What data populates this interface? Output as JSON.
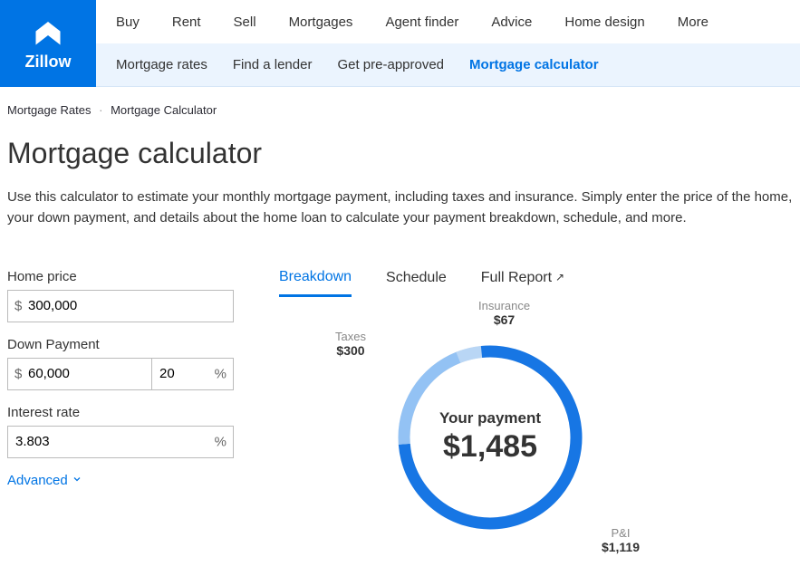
{
  "brand": "Zillow",
  "nav": {
    "primary": [
      "Buy",
      "Rent",
      "Sell",
      "Mortgages",
      "Agent finder",
      "Advice",
      "Home design",
      "More"
    ],
    "secondary": [
      "Mortgage rates",
      "Find a lender",
      "Get pre-approved",
      "Mortgage calculator"
    ],
    "secondary_active": 3
  },
  "breadcrumb": [
    "Mortgage Rates",
    "Mortgage Calculator"
  ],
  "page_title": "Mortgage calculator",
  "intro": "Use this calculator to estimate your monthly mortgage payment, including taxes and insurance. Simply enter the price of the home, your down payment, and details about the home loan to calculate your payment breakdown, schedule, and more.",
  "form": {
    "home_price_label": "Home price",
    "home_price_value": "300,000",
    "down_payment_label": "Down Payment",
    "down_payment_value": "60,000",
    "down_payment_pct": "20",
    "interest_rate_label": "Interest rate",
    "interest_rate_value": "3.803",
    "advanced_label": "Advanced",
    "currency_symbol": "$",
    "percent_symbol": "%"
  },
  "tabs": [
    {
      "label": "Breakdown",
      "active": true,
      "external": false
    },
    {
      "label": "Schedule",
      "active": false,
      "external": false
    },
    {
      "label": "Full Report",
      "active": false,
      "external": true
    }
  ],
  "donut": {
    "center_label": "Your payment",
    "center_value": "$1,485",
    "segments": {
      "insurance": {
        "label": "Insurance",
        "value": "$67"
      },
      "taxes": {
        "label": "Taxes",
        "value": "$300"
      },
      "pi": {
        "label": "P&I",
        "value": "$1,119"
      }
    }
  },
  "chart_data": {
    "type": "pie",
    "title": "Your payment",
    "total": 1485,
    "series": [
      {
        "name": "P&I",
        "value": 1119
      },
      {
        "name": "Taxes",
        "value": 300
      },
      {
        "name": "Insurance",
        "value": 67
      }
    ]
  }
}
